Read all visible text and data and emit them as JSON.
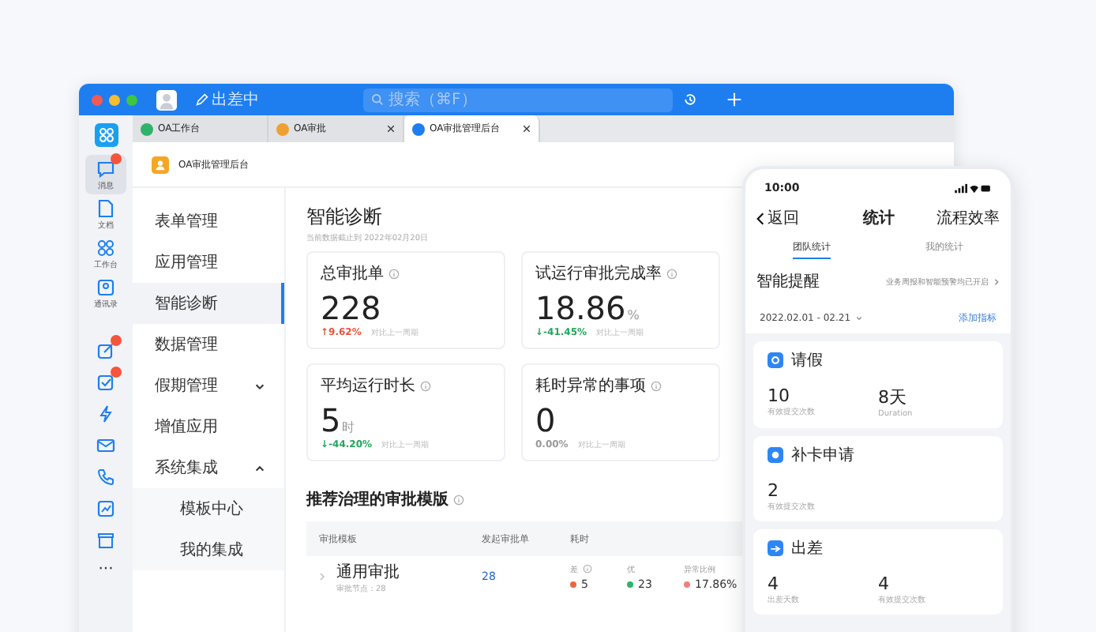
{
  "title_bar": {
    "status": "出差中",
    "search_placeholder": "搜索（⌘F）"
  },
  "tabs": [
    {
      "label": "OA工作台",
      "selected": false,
      "closable": false,
      "color": "#2fb36b"
    },
    {
      "label": "OA审批",
      "selected": false,
      "closable": true,
      "color": "#f0a030"
    },
    {
      "label": "OA审批管理后台",
      "selected": true,
      "closable": true,
      "color": "#1e7ef0"
    }
  ],
  "rail": {
    "items": [
      {
        "label": "消息",
        "kind": "chat",
        "selected": true,
        "badge": true
      },
      {
        "label": "文档",
        "kind": "doc",
        "selected": false,
        "badge": false
      },
      {
        "label": "工作台",
        "kind": "grid",
        "selected": false,
        "badge": false
      },
      {
        "label": "通讯录",
        "kind": "contact",
        "selected": false,
        "badge": false
      }
    ],
    "tools": [
      {
        "kind": "edit",
        "badge": true
      },
      {
        "kind": "check",
        "badge": true
      },
      {
        "kind": "bolt",
        "badge": false
      },
      {
        "kind": "mail",
        "badge": false
      },
      {
        "kind": "phone",
        "badge": false
      },
      {
        "kind": "chart",
        "badge": false
      },
      {
        "kind": "box",
        "badge": false
      }
    ],
    "more": "···"
  },
  "app_title": "OA审批管理后台",
  "menu": [
    {
      "label": "表单管理",
      "selected": false
    },
    {
      "label": "应用管理",
      "selected": false
    },
    {
      "label": "智能诊断",
      "selected": true
    },
    {
      "label": "数据管理",
      "selected": false
    },
    {
      "label": "假期管理",
      "selected": false,
      "expanded": false
    },
    {
      "label": "增值应用",
      "selected": false
    },
    {
      "label": "系统集成",
      "selected": false,
      "expanded": true,
      "children": [
        {
          "label": "模板中心",
          "selected": false
        },
        {
          "label": "我的集成",
          "selected": false
        }
      ]
    }
  ],
  "diagnosis": {
    "title": "智能诊断",
    "subtitle": "当前数据截止到 2022年02月20日",
    "cards": [
      {
        "label": "总审批单",
        "value": "228",
        "color": "#e8553b",
        "arrow": "↑",
        "change": "9.62%",
        "compare": "对比上一周期"
      },
      {
        "label": "试运行审批完成率",
        "value": "18.86",
        "unit": "%",
        "color": "#23a55a",
        "arrow": "↓",
        "change": "-41.45%",
        "compare": "对比上一周期"
      },
      {
        "label": "平均运行时长",
        "value": "5",
        "unit": "时",
        "color": "#23a55a",
        "arrow": "↓",
        "change": "-44.20%",
        "compare": "对比上一周期"
      },
      {
        "label": "耗时异常的事项",
        "value": "0",
        "color": "#999999",
        "change": "0.00%",
        "compare": "对比上一周期"
      }
    ]
  },
  "recommend": {
    "title": "推荐治理的审批模版",
    "columns": [
      "审批模板",
      "发起审批单",
      "耗时"
    ],
    "rows": [
      {
        "name": "通用审批",
        "nodes": "审批节点：28",
        "count": "28",
        "cost": [
          {
            "label": "差",
            "info": true,
            "value": "5",
            "color": "#f0643c"
          },
          {
            "label": "优",
            "value": "23",
            "color": "#2fb36b"
          },
          {
            "label": "异常比例",
            "value": "17.86%",
            "color": "#f08080"
          }
        ]
      }
    ]
  },
  "phone": {
    "time": "10:00",
    "back": "返回",
    "title": "统计",
    "action": "流程效率",
    "tabs": [
      {
        "label": "团队统计",
        "selected": true
      },
      {
        "label": "我的统计",
        "selected": false
      }
    ],
    "reminder": {
      "label": "智能提醒",
      "text": "业务周报和智能预警均已开启"
    },
    "date_range": "2022.02.01 - 02.21",
    "add_metric": "添加指标",
    "cards": [
      {
        "title": "请假",
        "kind": "leave",
        "stats": [
          {
            "value": "10",
            "label": "有效提交次数"
          },
          {
            "value": "8天",
            "label": "Duration"
          }
        ]
      },
      {
        "title": "补卡申请",
        "kind": "clock",
        "stats": [
          {
            "value": "2",
            "label": "有效提交次数"
          }
        ]
      },
      {
        "title": "出差",
        "kind": "plane",
        "stats": [
          {
            "value": "4",
            "label": "出差天数"
          },
          {
            "value": "4",
            "label": "有效提交次数"
          }
        ]
      }
    ]
  }
}
